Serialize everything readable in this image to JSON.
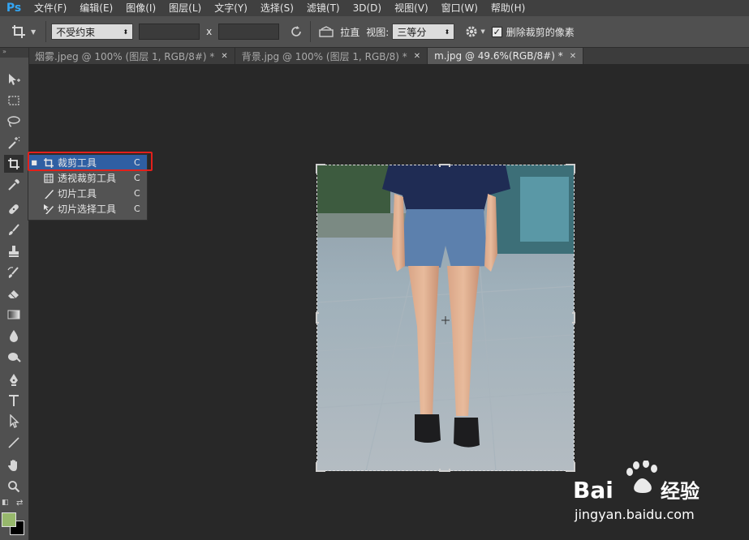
{
  "app": {
    "logo": "Ps"
  },
  "menu": [
    "文件(F)",
    "编辑(E)",
    "图像(I)",
    "图层(L)",
    "文字(Y)",
    "选择(S)",
    "滤镜(T)",
    "3D(D)",
    "视图(V)",
    "窗口(W)",
    "帮助(H)"
  ],
  "options": {
    "ratio_value": "不受约束",
    "ratio_separator": "x",
    "straighten_label": "拉直",
    "view_label": "视图:",
    "view_value": "三等分",
    "delete_pixels_label": "删除裁剪的像素",
    "delete_pixels_checked": true
  },
  "tabs": [
    {
      "label": "烟雾.jpeg @ 100% (图层 1, RGB/8#) *",
      "active": false
    },
    {
      "label": "背景.jpg @ 100% (图层 1, RGB/8) *",
      "active": false
    },
    {
      "label": "m.jpg @ 49.6%(RGB/8#) *",
      "active": true
    }
  ],
  "flyout": {
    "items": [
      {
        "label": "裁剪工具",
        "key": "C",
        "icon": "crop-icon",
        "active": true
      },
      {
        "label": "透视裁剪工具",
        "key": "C",
        "icon": "perspective-crop-icon",
        "active": false
      },
      {
        "label": "切片工具",
        "key": "C",
        "icon": "slice-icon",
        "active": false
      },
      {
        "label": "切片选择工具",
        "key": "C",
        "icon": "slice-select-icon",
        "active": false
      }
    ]
  },
  "colors": {
    "foreground": "#97b86c",
    "background": "#000000",
    "highlight": "#e3201b",
    "logo": "#33a6f5"
  },
  "watermark": {
    "brand": "Bai",
    "brand2": "经验",
    "url": "jingyan.baidu.com"
  }
}
